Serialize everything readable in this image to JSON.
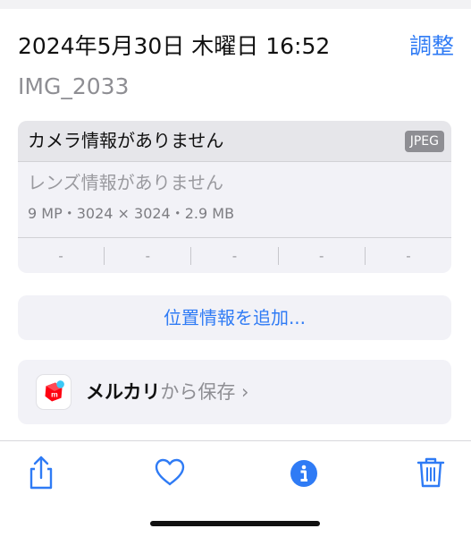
{
  "header": {
    "date_time": "2024年5月30日 木曜日 16:52",
    "adjust_label": "調整",
    "filename": "IMG_2033"
  },
  "info_card": {
    "camera_info": "カメラ情報がありません",
    "format_badge": "JPEG",
    "lens_info": "レンズ情報がありません",
    "specs": "9 MP・3024 × 3024・2.9 MB",
    "exif_values": [
      "-",
      "-",
      "-",
      "-",
      "-"
    ]
  },
  "location": {
    "add_label": "位置情報を追加..."
  },
  "app_source": {
    "app_name": "メルカリ",
    "suffix": "から保存 ›",
    "icon": "mercari-app-icon"
  },
  "toolbar": {
    "icons": [
      "share-icon",
      "heart-icon",
      "info-icon",
      "trash-icon"
    ]
  },
  "colors": {
    "accent": "#2f7bf5",
    "card_background": "#f2f2f7",
    "mercari_red": "#ff0211",
    "mercari_blue": "#3cc8f5"
  }
}
